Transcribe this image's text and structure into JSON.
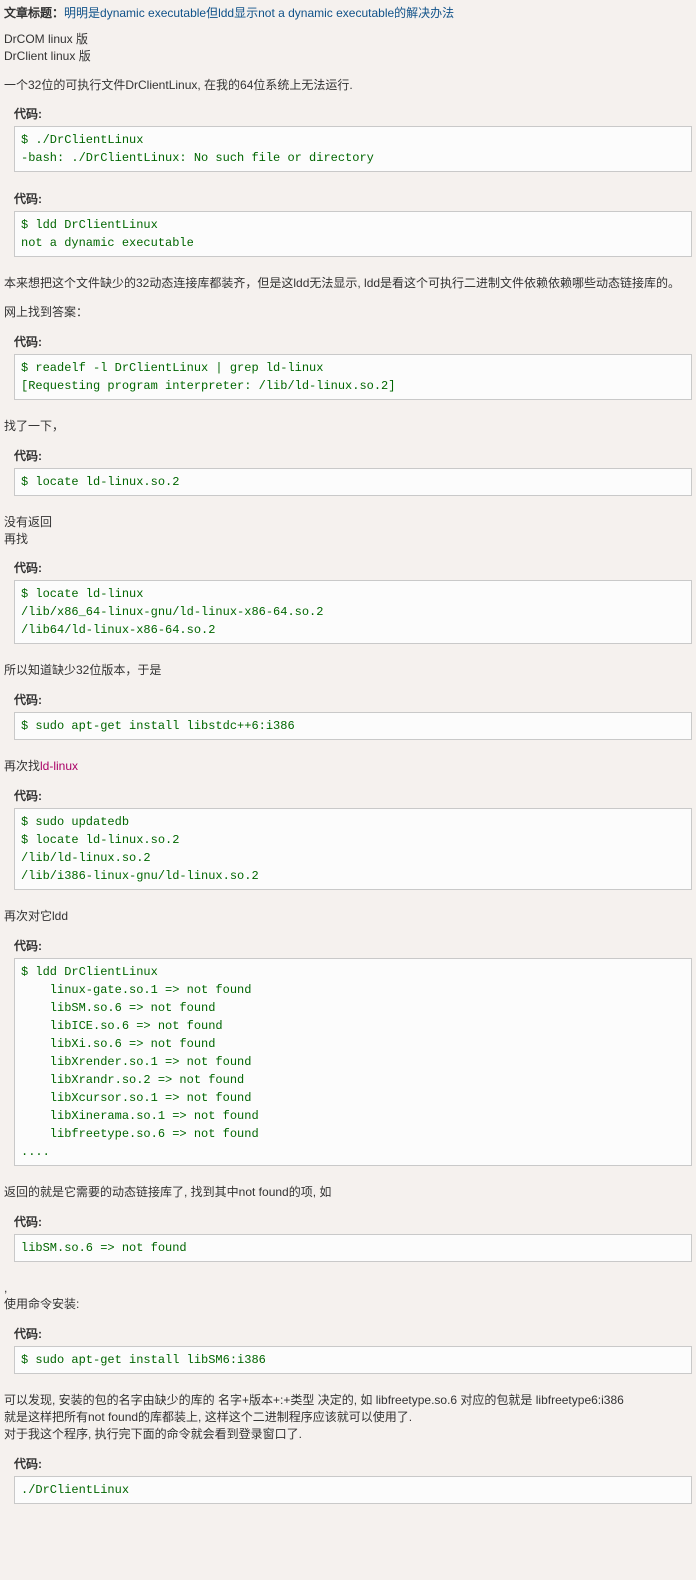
{
  "title_label": "文章标题：",
  "title_text": "明明是dynamic executable但ldd显示not a dynamic executable的解决办法",
  "p1_line1": "DrCOM linux 版",
  "p1_line2": "DrClient linux 版",
  "p2": "一个32位的可执行文件DrClientLinux, 在我的64位系统上无法运行.",
  "code_label": "代码:",
  "code1": "$ ./DrClientLinux\n-bash: ./DrClientLinux: No such file or directory",
  "code2": "$ ldd DrClientLinux\nnot a dynamic executable",
  "p3": "本来想把这个文件缺少的32动态连接库都装齐，但是这ldd无法显示, ldd是看这个可执行二进制文件依赖依赖哪些动态链接库的。",
  "p4": "网上找到答案：",
  "code3": "$ readelf -l DrClientLinux | grep ld-linux\n[Requesting program interpreter: /lib/ld-linux.so.2]",
  "p5": "找了一下，",
  "code4": "$ locate ld-linux.so.2",
  "p6_line1": "没有返回",
  "p6_line2": "再找",
  "code5": "$ locate ld-linux\n/lib/x86_64-linux-gnu/ld-linux-x86-64.so.2\n/lib64/ld-linux-x86-64.so.2",
  "p7": "所以知道缺少32位版本，于是",
  "code6": "$ sudo apt-get install libstdc++6:i386",
  "p8_prefix": "再次找",
  "p8_link": "ld-linux",
  "code7": "$ sudo updatedb\n$ locate ld-linux.so.2\n/lib/ld-linux.so.2\n/lib/i386-linux-gnu/ld-linux.so.2",
  "p9": "再次对它ldd",
  "code8": "$ ldd DrClientLinux\n    linux-gate.so.1 => not found\n    libSM.so.6 => not found\n    libICE.so.6 => not found\n    libXi.so.6 => not found\n    libXrender.so.1 => not found\n    libXrandr.so.2 => not found\n    libXcursor.so.1 => not found\n    libXinerama.so.1 => not found\n    libfreetype.so.6 => not found\n....",
  "p10": "返回的就是它需要的动态链接库了, 找到其中not found的项, 如",
  "code9": "libSM.so.6 => not found",
  "p11_line1": ",",
  "p11_line2": "使用命令安装:",
  "code10": "$ sudo apt-get install libSM6:i386",
  "p12_line1": "可以发现, 安装的包的名字由缺少的库的 名字+版本+:+类型 决定的, 如 libfreetype.so.6 对应的包就是 libfreetype6:i386",
  "p12_line2": "就是这样把所有not found的库都装上, 这样这个二进制程序应该就可以使用了.",
  "p12_line3": "对于我这个程序, 执行完下面的命令就会看到登录窗口了.",
  "code11": "./DrClientLinux"
}
